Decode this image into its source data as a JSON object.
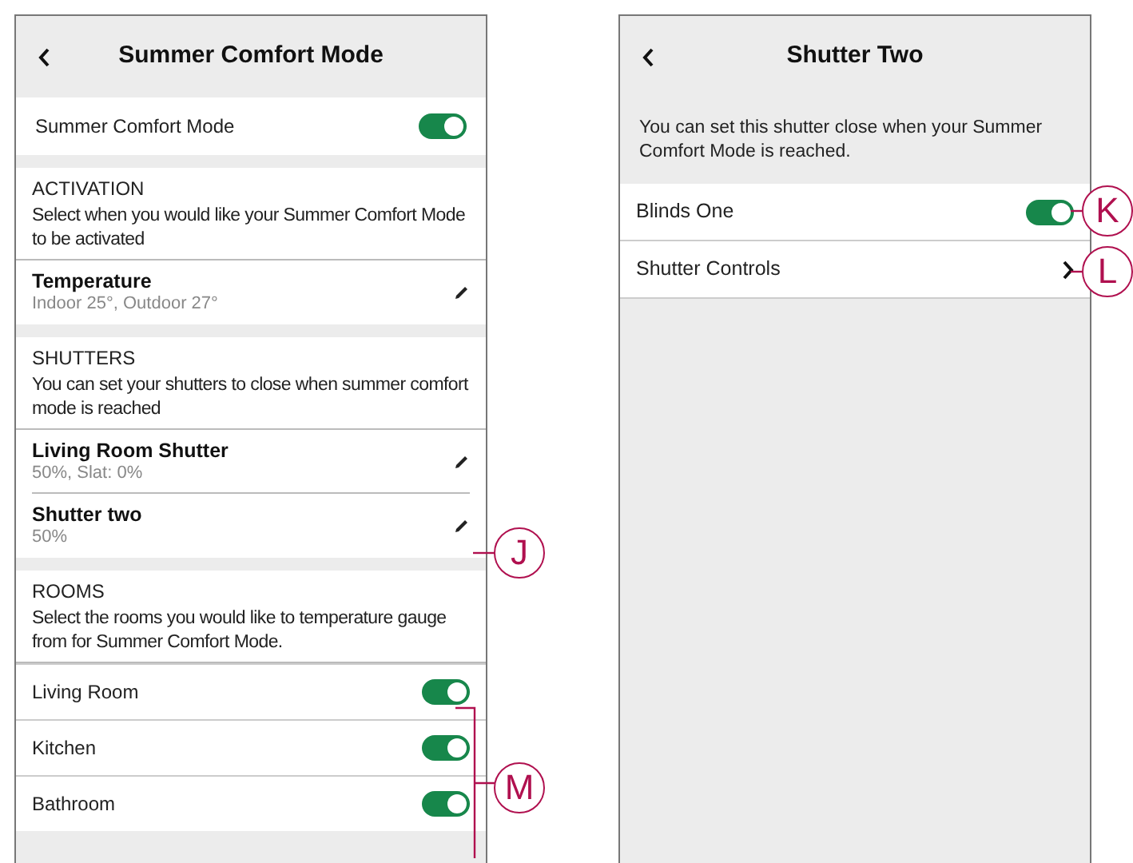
{
  "left_screen": {
    "title": "Summer Comfort Mode",
    "master": {
      "label": "Summer Comfort Mode",
      "on": true
    },
    "sections": [
      {
        "heading": "ACTIVATION",
        "description": "Select when you would like your Summer Comfort Mode to be activated",
        "items": [
          {
            "kind": "edit",
            "title": "Temperature",
            "subtitle": "Indoor 25°, Outdoor 27°"
          }
        ]
      },
      {
        "heading": "SHUTTERS",
        "description": "You can set your shutters to close when summer comfort mode is reached",
        "items": [
          {
            "kind": "edit",
            "title": "Living Room Shutter",
            "subtitle": "50%, Slat: 0%"
          },
          {
            "kind": "edit",
            "title": "Shutter two",
            "subtitle": "50%"
          }
        ]
      },
      {
        "heading": "ROOMS",
        "description": "Select the rooms you would like to temperature gauge from for Summer Comfort Mode.",
        "items": [
          {
            "kind": "toggle",
            "title": "Living Room",
            "on": true
          },
          {
            "kind": "toggle",
            "title": "Kitchen",
            "on": true
          },
          {
            "kind": "toggle",
            "title": "Bathroom",
            "on": true
          }
        ]
      }
    ]
  },
  "right_screen": {
    "title": "Shutter Two",
    "description": "You can set this shutter close when your Summer Comfort Mode is reached.",
    "rows": [
      {
        "kind": "toggle",
        "label": "Blinds One",
        "on": true
      },
      {
        "kind": "link",
        "label": "Shutter Controls"
      }
    ]
  },
  "callouts": [
    {
      "letter": "J"
    },
    {
      "letter": "K"
    },
    {
      "letter": "L"
    },
    {
      "letter": "M"
    }
  ]
}
